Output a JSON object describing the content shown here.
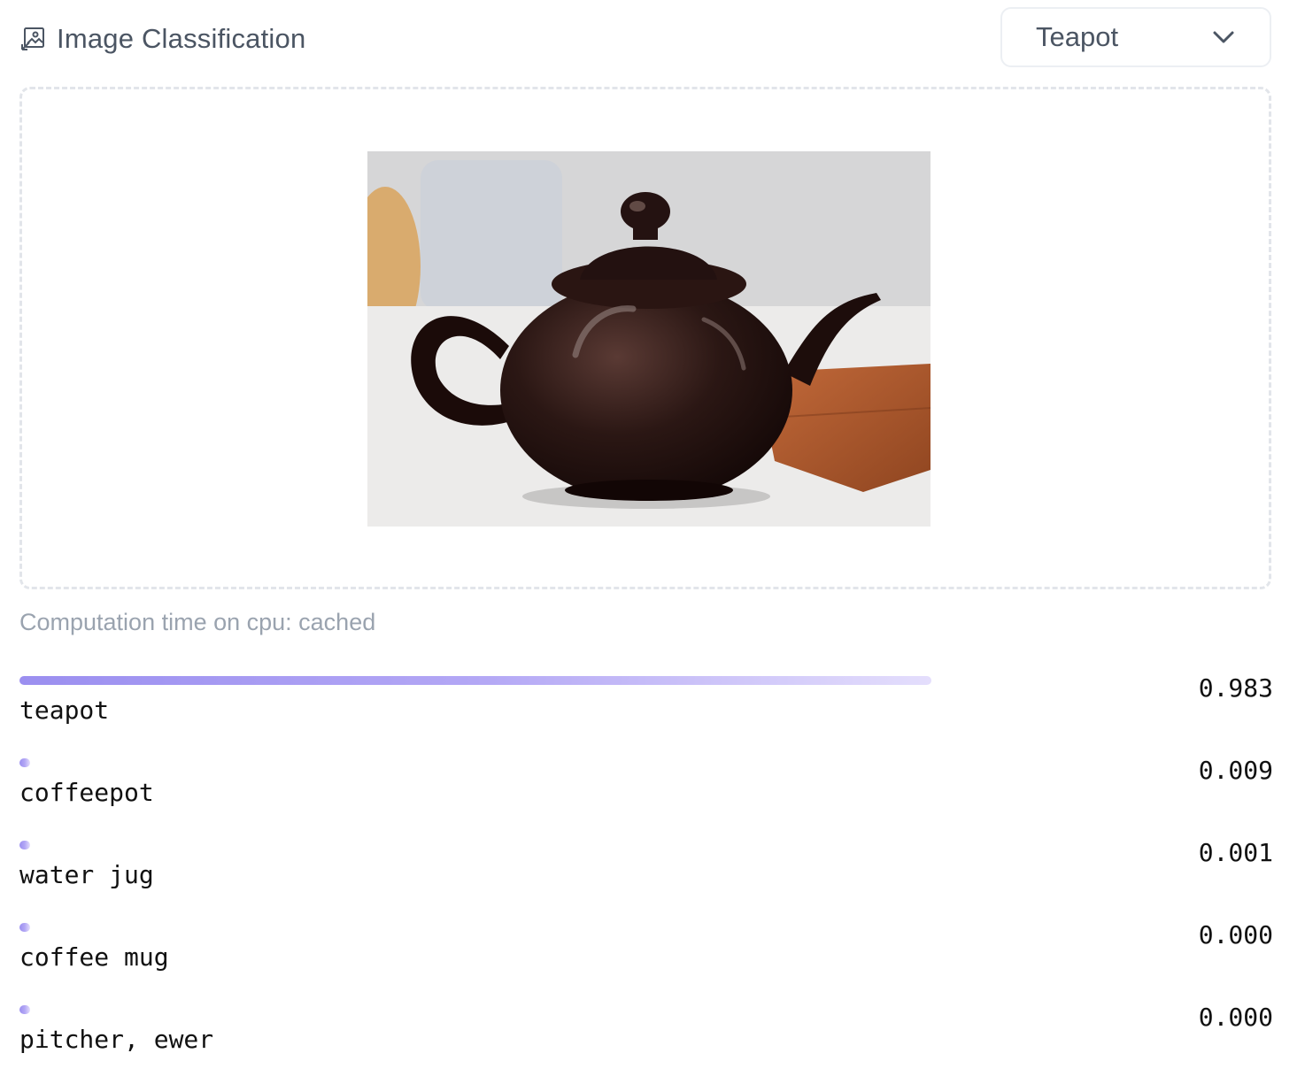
{
  "header": {
    "title": "Image Classification",
    "icon": "image-classification-icon"
  },
  "example_select": {
    "value": "Teapot",
    "icon": "chevron-down-icon"
  },
  "input_image": {
    "subject": "brown glazed teapot on a rust-colored napkin"
  },
  "status": {
    "computation_text": "Computation time on cpu: cached"
  },
  "colors": {
    "bar_start": "#9b8ff0",
    "bar_end": "#e4defc",
    "text": "#111111",
    "muted": "#9aa3af"
  },
  "results": [
    {
      "label": "teapot",
      "score_text": "0.983",
      "score": 0.983
    },
    {
      "label": "coffeepot",
      "score_text": "0.009",
      "score": 0.009
    },
    {
      "label": "water jug",
      "score_text": "0.001",
      "score": 0.001
    },
    {
      "label": "coffee mug",
      "score_text": "0.000",
      "score": 0.0
    },
    {
      "label": "pitcher, ewer",
      "score_text": "0.000",
      "score": 0.0
    }
  ]
}
